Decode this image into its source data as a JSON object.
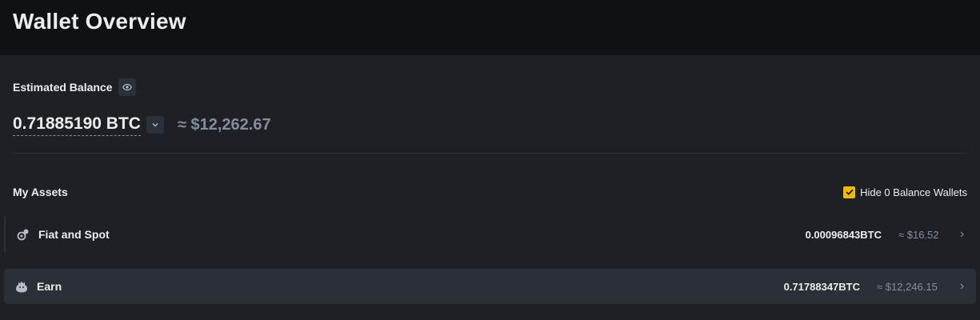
{
  "header": {
    "title": "Wallet Overview"
  },
  "balance": {
    "label": "Estimated Balance",
    "btc_value": "0.71885190 BTC",
    "usd_value": "≈ $12,262.67"
  },
  "assets": {
    "title": "My Assets",
    "hide_zero_label": "Hide 0 Balance Wallets",
    "hide_zero_checked": true,
    "items": [
      {
        "name": "Fiat and Spot",
        "btc": "0.00096843BTC",
        "usd": "≈ $16.52",
        "icon": "fiat-spot-icon"
      },
      {
        "name": "Earn",
        "btc": "0.71788347BTC",
        "usd": "≈ $12,246.15",
        "icon": "earn-piggy-icon"
      }
    ]
  },
  "colors": {
    "accent": "#f0b90b",
    "background": "#1e2026",
    "header_background": "#0f1115",
    "muted_text": "#848e9c"
  }
}
